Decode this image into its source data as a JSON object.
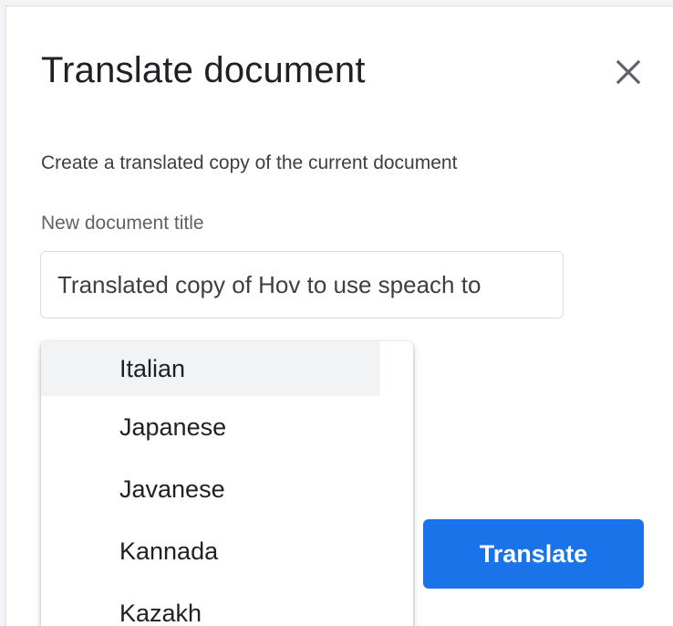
{
  "dialog": {
    "title": "Translate document",
    "close_icon": "close-icon",
    "description": "Create a translated copy of the current document",
    "title_field_label": "New document title",
    "title_field_value": "Translated copy of Hov to use speach to",
    "translate_button_label": "Translate"
  },
  "language_menu": {
    "items": [
      "Italian",
      "Japanese",
      "Javanese",
      "Kannada",
      "Kazakh"
    ],
    "highlighted": "Italian"
  },
  "colors": {
    "accent": "#1a73e8",
    "text_primary": "#202124",
    "text_secondary": "#5f6368",
    "highlight_bg": "#f1f3f4"
  }
}
